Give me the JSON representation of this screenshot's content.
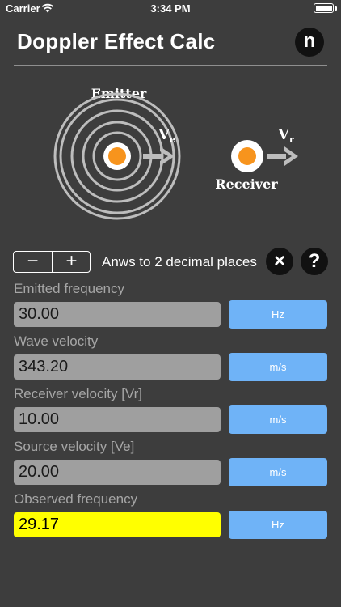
{
  "status_bar": {
    "carrier": "Carrier",
    "time": "3:34 PM"
  },
  "header": {
    "title": "Doppler Effect Calc",
    "logo_letter": "n"
  },
  "diagram": {
    "emitter_label": "Emitter",
    "receiver_label": "Receiver",
    "emitter_velocity_symbol": "V",
    "emitter_velocity_subscript": "e",
    "receiver_velocity_symbol": "V",
    "receiver_velocity_subscript": "r",
    "colors": {
      "ring": "#bdbdbd",
      "core": "#f7941d"
    }
  },
  "controls": {
    "minus_label": "−",
    "plus_label": "+",
    "decimals_text": "Anws to 2 decimal places",
    "clear_icon": "×",
    "help_icon": "?"
  },
  "fields": [
    {
      "label": "Emitted frequency",
      "value": "30.00",
      "unit": "Hz"
    },
    {
      "label": "Wave velocity",
      "value": "343.20",
      "unit": "m/s"
    },
    {
      "label": "Receiver velocity [Vr]",
      "value": "10.00",
      "unit": "m/s"
    },
    {
      "label": "Source velocity [Ve]",
      "value": "20.00",
      "unit": "m/s"
    },
    {
      "label": "Observed frequency",
      "value": "29.17",
      "unit": "Hz"
    }
  ],
  "colors": {
    "background": "#3d3d3d",
    "input_background": "#9f9f9f",
    "result_background": "#ffff00",
    "unit_button": "#6fb3f7"
  }
}
